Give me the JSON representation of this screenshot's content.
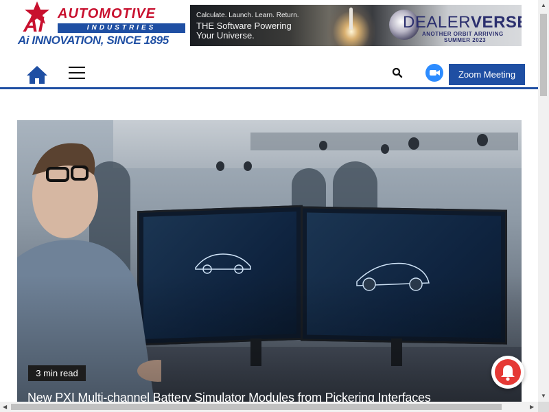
{
  "header": {
    "logo_text_top": "AUTOMOTIVE",
    "logo_text_bottom": "INDUSTRIES",
    "logo_mark": "Ai",
    "tagline": "Ai INNOVATION, SINCE 1895"
  },
  "ad": {
    "line1": "Calculate. Launch. Learn. Return.",
    "line2": "THE Software Powering",
    "line3": "Your Universe.",
    "brand_a": "DEALER",
    "brand_b": "VERSE",
    "brand_tm": "™",
    "sub1": "ANOTHER ORBIT ARRIVING",
    "sub2": "SUMMER 2023"
  },
  "nav": {
    "home_icon": "home-icon",
    "menu_icon": "hamburger-menu-icon",
    "search_icon": "search-icon",
    "zoom_icon": "zoom-video-icon",
    "zoom_button": "Zoom Meeting"
  },
  "hero": {
    "read_time": "3 min read",
    "title": "New PXI Multi-channel Battery Simulator Modules from Pickering Interfaces"
  },
  "colors": {
    "brand_blue": "#1f4fa3",
    "brand_red": "#c8102e",
    "zoom_blue": "#2d8cff",
    "bell_red": "#e53935"
  }
}
